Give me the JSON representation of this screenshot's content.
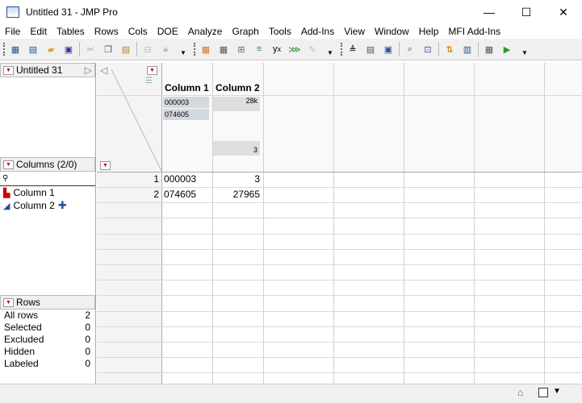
{
  "window": {
    "title": "Untitled 31 - JMP Pro",
    "minimize": "—",
    "maximize": "☐",
    "close": "✕"
  },
  "menu": [
    "File",
    "Edit",
    "Tables",
    "Rows",
    "Cols",
    "DOE",
    "Analyze",
    "Graph",
    "Tools",
    "Add-Ins",
    "View",
    "Window",
    "Help",
    "MFI Add-Ins"
  ],
  "table_panel": {
    "name": "Untitled 31"
  },
  "columns_panel": {
    "title": "Columns (2/0)",
    "items": [
      {
        "name": "Column 1",
        "type": "nominal"
      },
      {
        "name": "Column 2",
        "type": "continuous"
      }
    ]
  },
  "rows_panel": {
    "title": "Rows",
    "stats": [
      {
        "label": "All rows",
        "value": "2"
      },
      {
        "label": "Selected",
        "value": "0"
      },
      {
        "label": "Excluded",
        "value": "0"
      },
      {
        "label": "Hidden",
        "value": "0"
      },
      {
        "label": "Labeled",
        "value": "0"
      }
    ]
  },
  "grid": {
    "headers": [
      "Column 1",
      "Column 2"
    ],
    "col1_summary": [
      "000003",
      "074605"
    ],
    "col2_summary": {
      "max": "28k",
      "min": "3"
    },
    "rows": [
      {
        "n": "1",
        "c1": "000003",
        "c2": "3"
      },
      {
        "n": "2",
        "c1": "074605",
        "c2": "27965"
      }
    ]
  }
}
